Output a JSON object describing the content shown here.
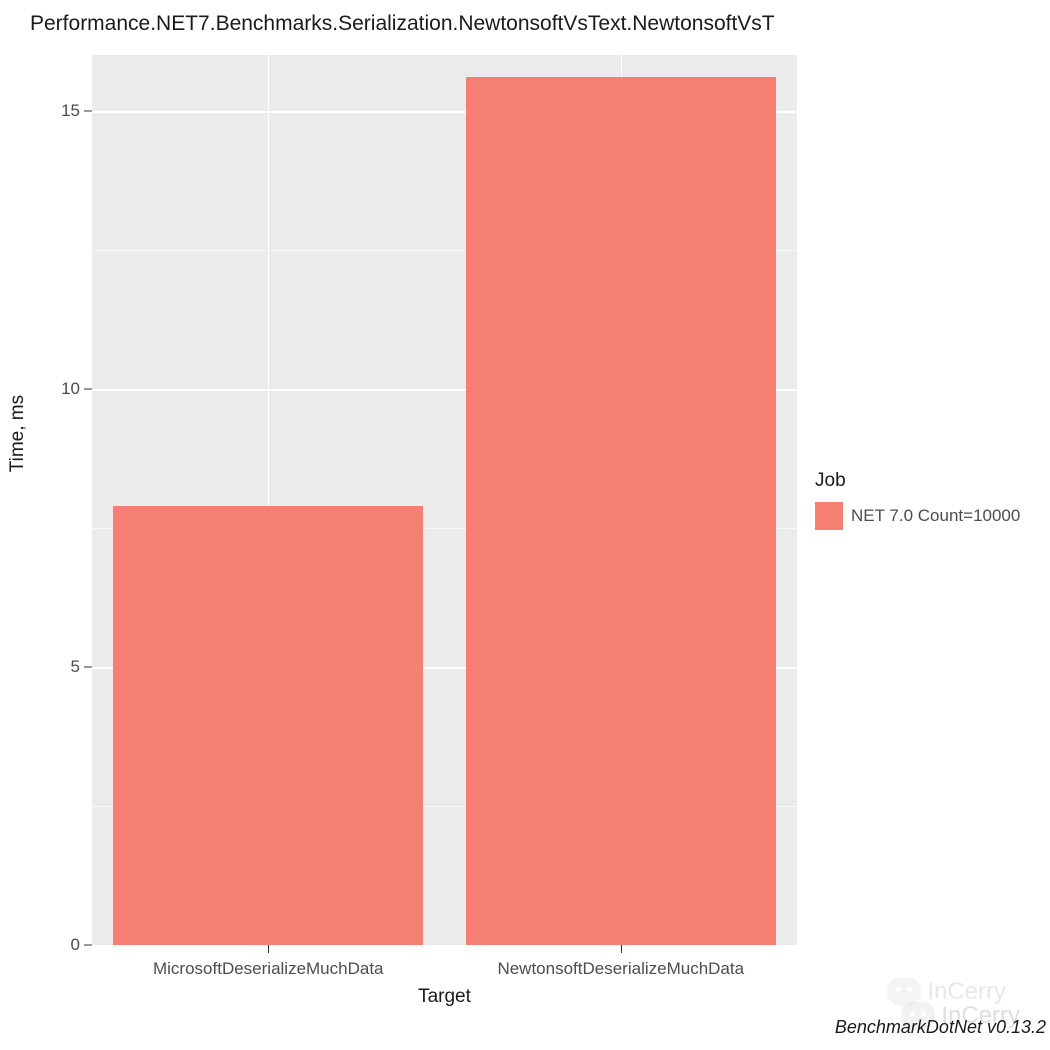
{
  "chart_data": {
    "type": "bar",
    "title": "Performance.NET7.Benchmarks.Serialization.NewtonsoftVsText.NewtonsoftVsT",
    "xlabel": "Target",
    "ylabel": "Time, ms",
    "categories": [
      "MicrosoftDeserializeMuchData",
      "NewtonsoftDeserializeMuchData"
    ],
    "values": [
      7.9,
      15.6
    ],
    "ylim": [
      0,
      16
    ],
    "y_ticks": [
      0,
      5,
      10,
      15
    ],
    "legend_title": "Job",
    "series_name": "NET 7.0 Count=10000",
    "bar_color": "#F47F72"
  },
  "footer": "BenchmarkDotNet v0.13.2",
  "watermark": "InCerry"
}
